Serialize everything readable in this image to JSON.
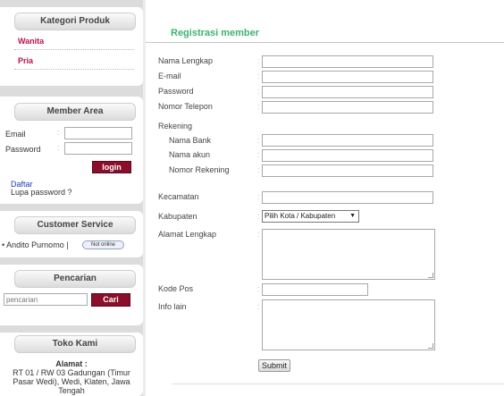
{
  "sidebar": {
    "kategori": {
      "title": "Kategori Produk",
      "items": [
        "Wanita",
        "Pria"
      ]
    },
    "member_area": {
      "title": "Member Area",
      "email_label": "Email",
      "password_label": "Password",
      "login_label": "login",
      "daftar_label": "Daftar",
      "lupa_label": "Lupa password ?"
    },
    "customer_service": {
      "title": "Customer Service",
      "contact_name": "• Andito Purnomo |",
      "status": "Not online"
    },
    "pencarian": {
      "title": "Pencarian",
      "placeholder": "pencarian",
      "button_label": "Cari"
    },
    "toko_kami": {
      "title": "Toko Kami",
      "alamat_label": "Alamat :",
      "address": "RT 01 / RW 03 Gadungan (Timur Pasar Wedi), Wedi, Klaten, Jawa Tengah"
    }
  },
  "main": {
    "title": "Registrasi member",
    "labels": {
      "nama_lengkap": "Nama Lengkap",
      "email": "E-mail",
      "password": "Password",
      "nomor_telepon": "Nomor Telepon",
      "rekening": "Rekening",
      "nama_bank": "Nama Bank",
      "nama_akun": "Nama akun",
      "nomor_rekening": "Nomor Rekening",
      "kecamatan": "Kecamatan",
      "kabupaten": "Kabupaten",
      "alamat_lengkap": "Alamat Lengkap",
      "kode_pos": "Kode Pos",
      "info_lain": "Info lain"
    },
    "colon": ":",
    "kabupaten_selected": "Pilih Kota / Kabupaten",
    "submit_label": "Submit"
  },
  "colors": {
    "title_green": "#3cb371",
    "category_link": "#c0104a",
    "button_red": "#8b0e2b",
    "link_blue": "#1a3fb0"
  }
}
